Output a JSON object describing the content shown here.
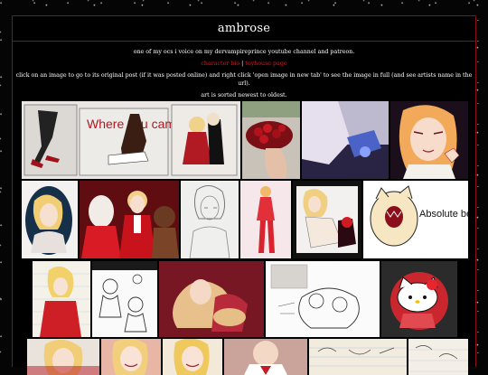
{
  "page": {
    "title": "ambrose",
    "intro_line": "one of my ocs i voice on my dervampireprince youtube channel and patreon.",
    "links": [
      {
        "label": "character bio"
      },
      {
        "label": "toyhouse page"
      }
    ],
    "link_separator": "|",
    "instructions": "click on an image to go to its original post (if it was posted online) and right click 'open image in new tab' to see the image in full (and see artists name in the url).",
    "sort_note": "art is sorted newest to oldest."
  },
  "colors": {
    "accent_red": "#d11b22",
    "border_red": "#8c0d12",
    "background": "#000000",
    "text": "#ffffff"
  },
  "gallery": {
    "images": [
      {
        "icon": "comic-where-you-came-from",
        "caption": "Where you came From"
      },
      {
        "icon": "cherries-photo"
      },
      {
        "icon": "blue-bottle-photo"
      },
      {
        "icon": "vampire-portrait-wink"
      },
      {
        "icon": "portrait-blonde-oval"
      },
      {
        "icon": "red-vampire-trio"
      },
      {
        "icon": "pencil-sketch-portrait"
      },
      {
        "icon": "pink-figure-standing"
      },
      {
        "icon": "pose-with-cat"
      },
      {
        "icon": "absolute-beast-sticker",
        "caption": "Absolute beast!"
      },
      {
        "icon": "notebook-drawing"
      },
      {
        "icon": "lineart-sketch-pair"
      },
      {
        "icon": "red-cuddle-painting"
      },
      {
        "icon": "lineart-hug-sketch"
      },
      {
        "icon": "hello-kitty-badge"
      },
      {
        "icon": "blonde-portrait-red"
      },
      {
        "icon": "smiling-face-pink"
      },
      {
        "icon": "smiling-face-yellow"
      },
      {
        "icon": "collar-portrait"
      },
      {
        "icon": "lined-paper-doodle"
      },
      {
        "icon": "pencil-notes-doodle"
      }
    ]
  }
}
